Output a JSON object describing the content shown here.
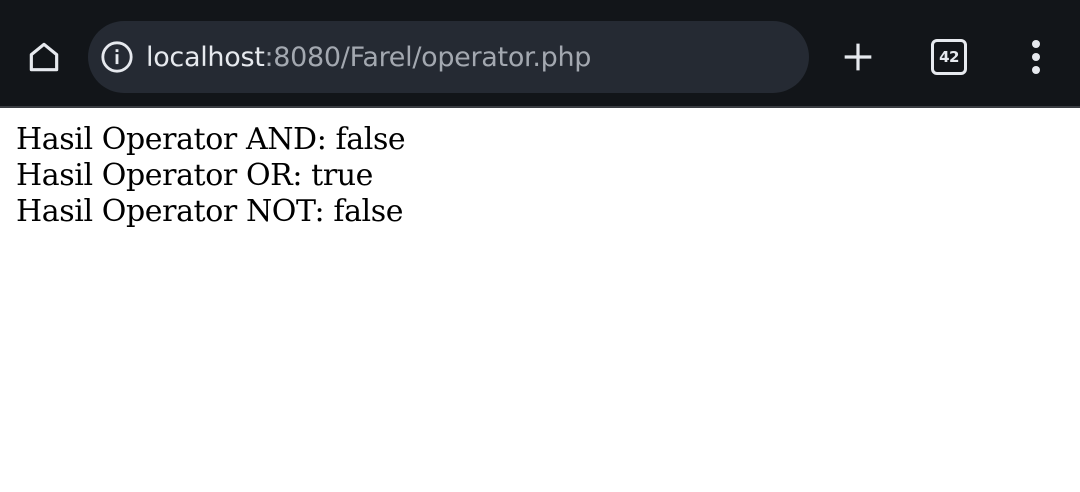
{
  "toolbar": {
    "home_icon": "home-icon",
    "info_icon": "info-icon",
    "url_host": "localhost",
    "url_path": ":8080/Farel/operator.php",
    "new_tab_icon": "plus-icon",
    "tab_count": "42",
    "menu_icon": "more-vert-icon",
    "background_color": "#121519",
    "omnibox_color": "#252a33"
  },
  "page": {
    "lines": [
      "Hasil Operator AND: false",
      "Hasil Operator OR: true",
      "Hasil Operator NOT: false"
    ]
  }
}
